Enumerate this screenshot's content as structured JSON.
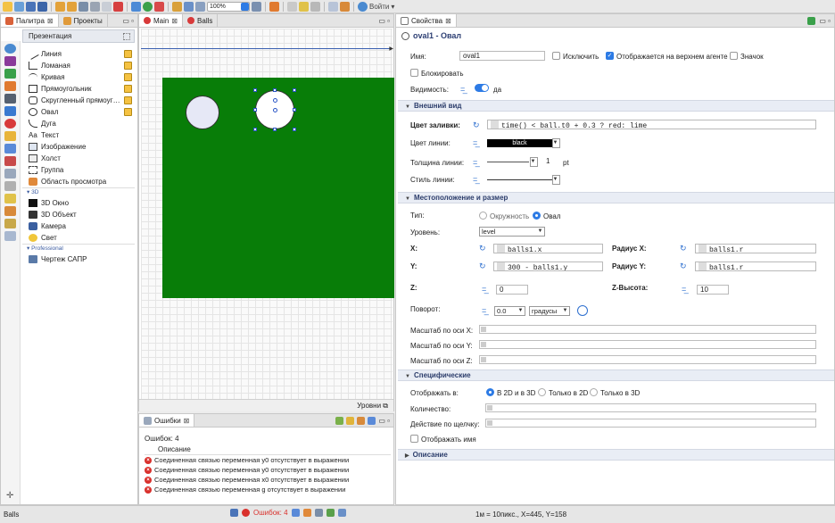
{
  "toolbar": {
    "zoom": "100%",
    "login": "Войти"
  },
  "left_tabs": {
    "palette": "Палитра",
    "projects": "Проекты"
  },
  "palette": {
    "header": "Презентация",
    "items": [
      "Линия",
      "Ломаная",
      "Кривая",
      "Прямоугольник",
      "Скругленный прямоуг…",
      "Овал",
      "Дуга",
      "Текст",
      "Изображение",
      "Холст",
      "Группа",
      "Область просмотра"
    ],
    "section_3d": "3D",
    "items_3d": [
      "3D Окно",
      "3D Объект",
      "Камера",
      "Свет"
    ],
    "section_pro": "Professional",
    "items_pro": [
      "Чертеж САПР"
    ]
  },
  "editor": {
    "tabs": [
      "Main",
      "Balls"
    ],
    "levels": "Уровни"
  },
  "errors": {
    "tab": "Ошибки",
    "count_label": "Ошибок: 4",
    "column": "Описание",
    "rows": [
      "Соединенная связью переменная y0 отсутствует в выражении",
      "Соединенная связью переменная y0 отсутствует в выражении",
      "Соединенная связью переменная x0 отсутствует в выражении",
      "Соединенная связью переменная g отсутствует в выражении"
    ]
  },
  "props": {
    "tab": "Свойства",
    "title": "oval1 - Овал",
    "name_label": "Имя:",
    "name_value": "oval1",
    "exclude": "Исключить",
    "show_top": "Отображается на верхнем агенте",
    "icon": "Значок",
    "lock": "Блокировать",
    "visibility": "Видимость:",
    "visibility_value": "да",
    "sec_view": "Внешний вид",
    "fill_label": "Цвет заливки:",
    "fill_value": "time() < ball.t0 + 0.3 ? red: lime",
    "line_color_label": "Цвет линии:",
    "line_color_value": "black",
    "line_width_label": "Толщина линии:",
    "line_width_value": "1",
    "line_width_unit": "pt",
    "line_style_label": "Стиль линии:",
    "sec_pos": "Местоположение и размер",
    "type_label": "Тип:",
    "type_circle": "Окружность",
    "type_oval": "Овал",
    "level_label": "Уровень:",
    "level_value": "level",
    "x_label": "X:",
    "x_value": "balls1.x",
    "rx_label": "Радиус X:",
    "rx_value": "balls1.r",
    "y_label": "Y:",
    "y_value": "300 - balls1.y",
    "ry_label": "Радиус Y:",
    "ry_value": "balls1.r",
    "z_label": "Z:",
    "z_value": "0",
    "zh_label": "Z-Высота:",
    "zh_value": "10",
    "rot_label": "Поворот:",
    "rot_value": "0.0",
    "rot_unit": "градусы",
    "sx_label": "Масштаб по оси X:",
    "sy_label": "Масштаб по оси Y:",
    "sz_label": "Масштаб по оси Z:",
    "sec_spec": "Специфические",
    "show_in_label": "Отображать в:",
    "show_2d3d": "В 2D и в 3D",
    "show_2d": "Только в 2D",
    "show_3d": "Только в 3D",
    "qty_label": "Количество:",
    "click_label": "Действие по щелчку:",
    "show_name": "Отображать имя",
    "sec_desc": "Описание"
  },
  "status": {
    "left": "Balls",
    "errors": "Ошибок: 4",
    "coords": "1м = 10пикс., X=445, Y=158"
  },
  "colors": {
    "green_area": "#087d08",
    "accent": "#2d7be5"
  }
}
